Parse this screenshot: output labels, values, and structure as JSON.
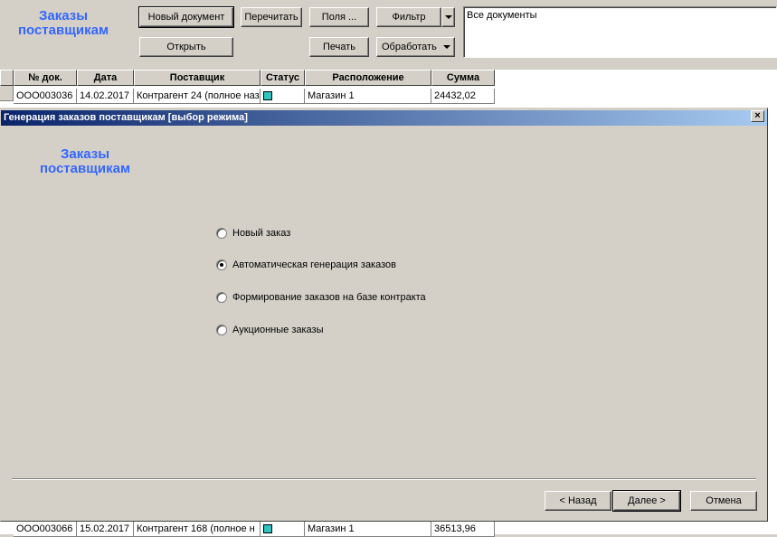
{
  "header": {
    "title_line1": "Заказы",
    "title_line2": "поставщикам"
  },
  "toolbar": {
    "new_doc": "Новый документ",
    "recalc": "Перечитать",
    "fields": "Поля ...",
    "filter": "Фильтр",
    "open": "Открыть",
    "print": "Печать",
    "process": "Обработать"
  },
  "filter_box": {
    "text": "Все документы"
  },
  "grid": {
    "columns": [
      "№ док.",
      "Дата",
      "Поставщик",
      "Статус",
      "Расположение",
      "Сумма"
    ],
    "rows": [
      {
        "num": "ООО003036",
        "date": "14.02.2017",
        "supplier": "Контрагент 24 (полное наз",
        "location": "Магазин 1",
        "sum": "24432,02"
      },
      {
        "num": "ООО003066",
        "date": "15.02.2017",
        "supplier": "Контрагент 168 (полное н",
        "location": "Магазин 1",
        "sum": "36513,96"
      }
    ]
  },
  "dialog": {
    "title": "Генерация заказов поставщикам [выбор режима]",
    "close_glyph": "×",
    "heading_line1": "Заказы",
    "heading_line2": "поставщикам",
    "options": [
      {
        "label": "Новый заказ",
        "checked": false
      },
      {
        "label": "Автоматическая генерация заказов",
        "checked": true
      },
      {
        "label": "Формирование заказов на базе контракта",
        "checked": false
      },
      {
        "label": "Аукционные заказы",
        "checked": false
      }
    ],
    "back": "< Назад",
    "next": "Далее >",
    "cancel": "Отмена"
  }
}
